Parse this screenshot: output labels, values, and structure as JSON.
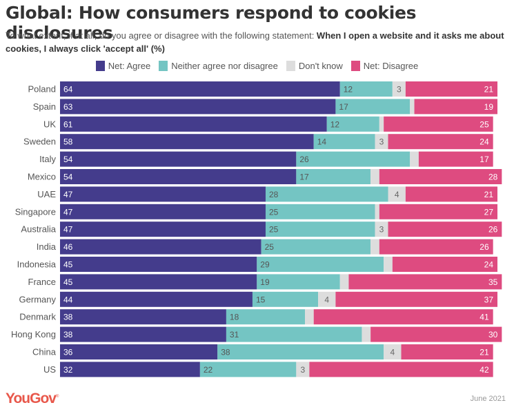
{
  "header": {
    "title": "Global: How consumers respond to cookies disclosures",
    "subtitle_plain": "To what extent, if at all, do you agree or disagree with the following statement: ",
    "subtitle_bold": "When I open a website and it asks me about cookies, I always click 'accept all' (%)"
  },
  "footer": {
    "logo": "YouGov",
    "date": "June 2021"
  },
  "chart_data": {
    "type": "bar",
    "stacked": true,
    "orientation": "horizontal",
    "title": "Global: How consumers respond to cookies disclosures",
    "xlabel": "",
    "ylabel": "",
    "xlim": [
      0,
      100
    ],
    "legend_position": "top-center",
    "categories": [
      "Poland",
      "Spain",
      "UK",
      "Sweden",
      "Italy",
      "Mexico",
      "UAE",
      "Singapore",
      "Australia",
      "India",
      "Indonesia",
      "France",
      "Germany",
      "Denmark",
      "Hong Kong",
      "China",
      "US"
    ],
    "series": [
      {
        "name": "Net: Agree",
        "color": "#443c8c",
        "label_color": "#ffffff",
        "values": [
          64,
          63,
          61,
          58,
          54,
          54,
          47,
          47,
          47,
          46,
          45,
          45,
          44,
          38,
          38,
          36,
          32
        ],
        "labeled": [
          true,
          true,
          true,
          true,
          true,
          true,
          true,
          true,
          true,
          true,
          true,
          true,
          true,
          true,
          true,
          true,
          true
        ]
      },
      {
        "name": "Neither agree nor disagree",
        "color": "#74c5c3",
        "label_color": "#555555",
        "values": [
          12,
          17,
          12,
          14,
          26,
          17,
          28,
          25,
          25,
          25,
          29,
          19,
          15,
          18,
          31,
          38,
          22
        ],
        "labeled": [
          true,
          true,
          true,
          true,
          true,
          true,
          true,
          true,
          true,
          true,
          true,
          true,
          true,
          true,
          true,
          true,
          true
        ]
      },
      {
        "name": "Don't know",
        "color": "#dddddd",
        "label_color": "#666666",
        "values": [
          3,
          1,
          1,
          3,
          2,
          2,
          4,
          1,
          3,
          2,
          2,
          2,
          4,
          2,
          2,
          4,
          3
        ],
        "labeled": [
          true,
          false,
          false,
          true,
          false,
          false,
          true,
          false,
          true,
          false,
          false,
          false,
          true,
          false,
          false,
          true,
          true
        ]
      },
      {
        "name": "Net: Disagree",
        "color": "#de4b80",
        "label_color": "#ffffff",
        "values": [
          21,
          19,
          25,
          24,
          17,
          28,
          21,
          27,
          26,
          26,
          24,
          35,
          37,
          41,
          30,
          21,
          42
        ],
        "labeled": [
          true,
          true,
          true,
          true,
          true,
          true,
          true,
          true,
          true,
          true,
          true,
          true,
          true,
          true,
          true,
          true,
          true
        ]
      }
    ]
  }
}
